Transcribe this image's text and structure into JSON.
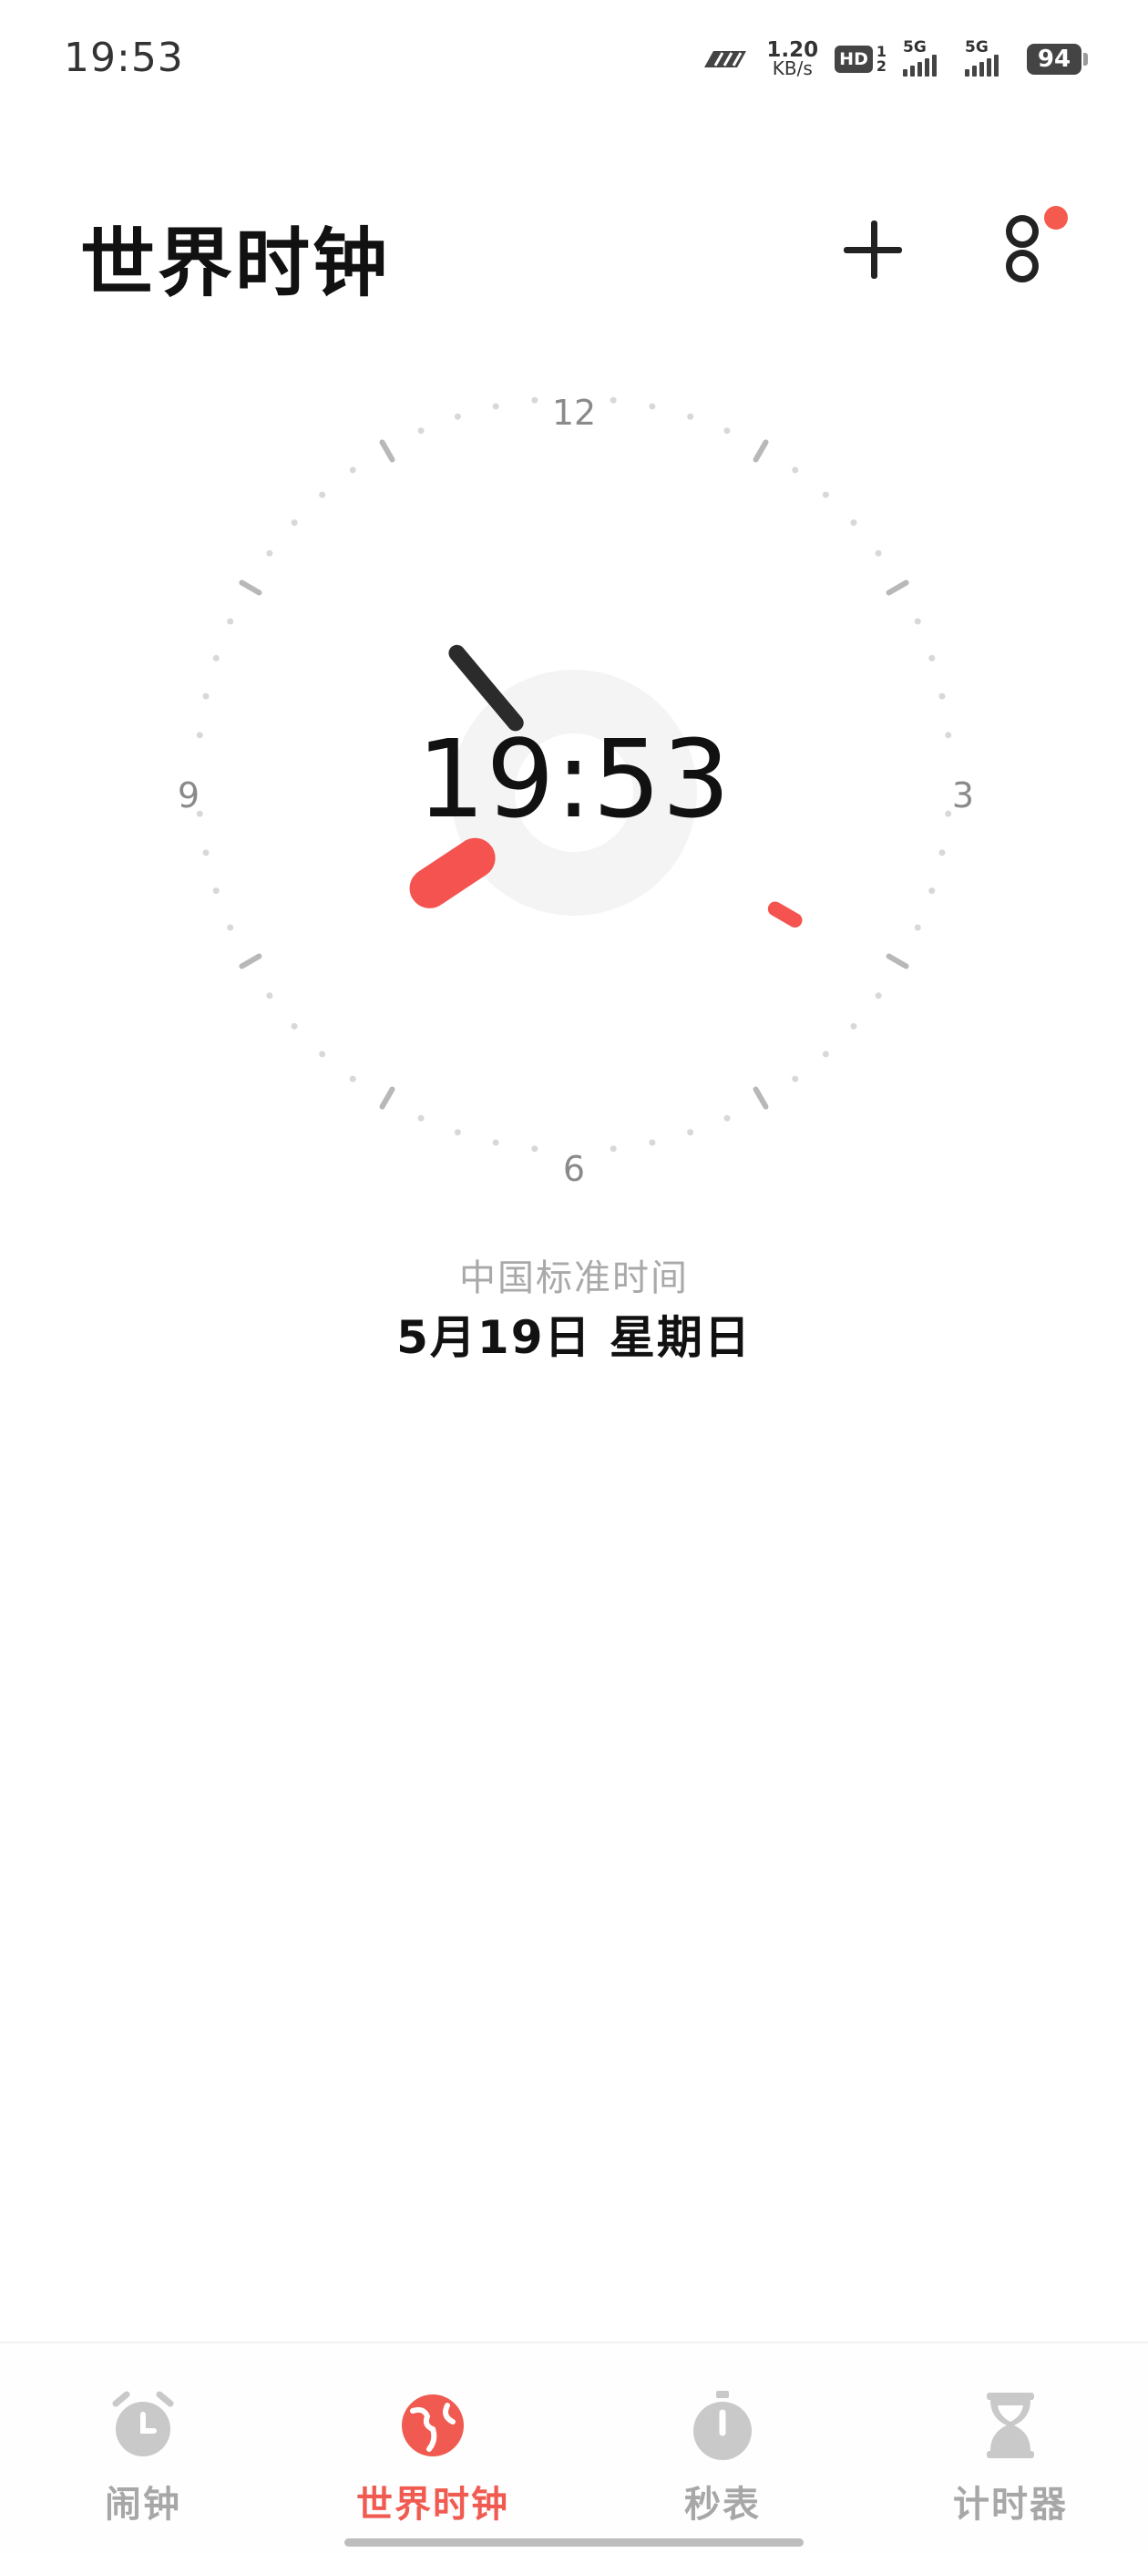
{
  "status_bar": {
    "time": "19:53",
    "net_speed_value": "1.20",
    "net_speed_unit": "KB/s",
    "hd_label": "HD",
    "hd_sup": "1",
    "hd_sub": "2",
    "sim1_label": "5G",
    "sim2_label": "5G",
    "battery": "94"
  },
  "header": {
    "title": "世界时钟",
    "add_icon": "plus-icon",
    "more_icon": "more-icon",
    "has_notification_dot": true
  },
  "clock": {
    "numerals": {
      "n12": "12",
      "n3": "3",
      "n6": "6",
      "n9": "9"
    },
    "digital_time": "19:53",
    "hour": 19,
    "minute": 53,
    "second": 20,
    "accent_color": "#f5534f",
    "hand_color": "#2b2b2b"
  },
  "location": {
    "timezone": "中国标准时间",
    "date": "5月19日 星期日"
  },
  "bottom_nav": {
    "items": [
      {
        "label": "闹钟",
        "icon": "alarm-clock-icon",
        "active": false
      },
      {
        "label": "世界时钟",
        "icon": "globe-icon",
        "active": true
      },
      {
        "label": "秒表",
        "icon": "stopwatch-icon",
        "active": false
      },
      {
        "label": "计时器",
        "icon": "hourglass-icon",
        "active": false
      }
    ],
    "active_color": "#f05a50",
    "inactive_color": "#a7a7a7"
  }
}
